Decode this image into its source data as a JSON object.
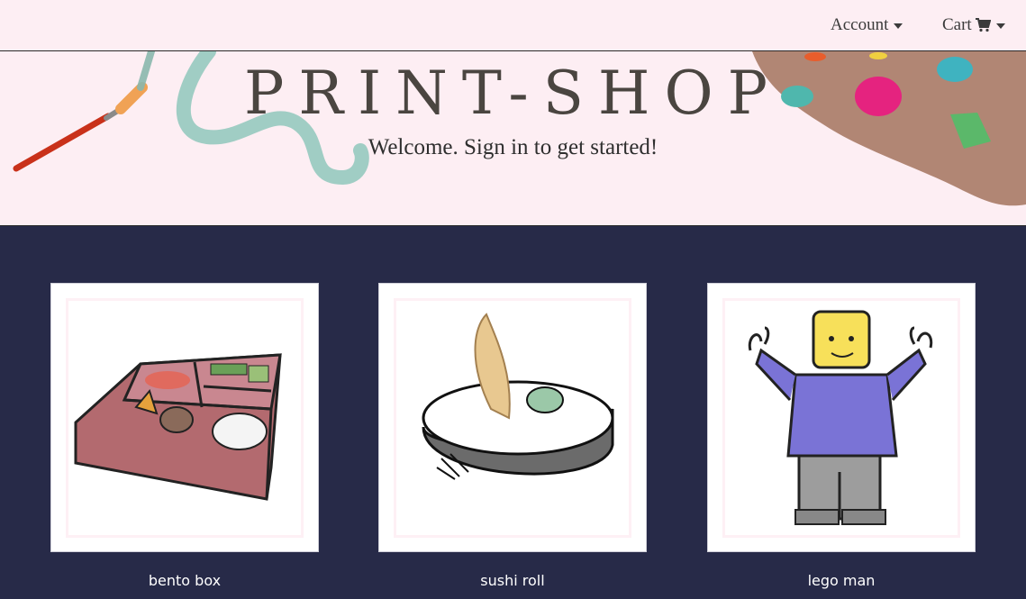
{
  "nav": {
    "account_label": "Account",
    "cart_label": "Cart"
  },
  "hero": {
    "title": "PRINT-SHOP",
    "subtitle": "Welcome. Sign in to get started!"
  },
  "products": [
    {
      "name": "bento box",
      "icon": "bento-box-illustration"
    },
    {
      "name": "sushi roll",
      "icon": "sushi-roll-illustration"
    },
    {
      "name": "lego man",
      "icon": "lego-man-illustration"
    }
  ],
  "colors": {
    "background": "#272a48",
    "header_bg": "#fdeef3",
    "card_bg": "#ffffff",
    "card_inner": "#fef0f5"
  }
}
